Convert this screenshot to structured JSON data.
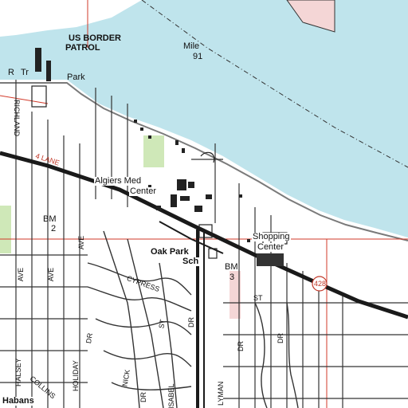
{
  "map": {
    "colors": {
      "water": "#bfe4ec",
      "land": "#ffffff",
      "grid_line": "#d23a2a",
      "road": "#1a1a1a",
      "park": "#cfe8b8",
      "building": "#222222",
      "urban_pink": "#f4d6d6"
    },
    "labels": {
      "us_border_patrol_1": "US BORDER",
      "us_border_patrol_2": "PATROL",
      "mile": "Mile",
      "mile_number": "91",
      "park_r": "R",
      "park_tr": "Tr",
      "park": "Park",
      "richland": "RICHLAND",
      "lane": "4 LANE",
      "algiers_med_1": "Algiers Med",
      "algiers_med_2": "Center",
      "bm_left": "BM",
      "bm_left_num": "2",
      "shopping_1": "Shopping",
      "shopping_2": "Center",
      "oak_park_1": "Oak Park",
      "oak_park_2": "Sch",
      "bm_right": "BM",
      "bm_right_num": "3",
      "route_shield": "428",
      "halsey": "HALSEY",
      "ave_1": "AVE",
      "ave_2": "AVE",
      "ave_3": "AVE",
      "collins": "COLLINS",
      "holiday": "HOLIDAY",
      "nick": "NICK",
      "dr_1": "DR",
      "dr_2": "DR",
      "dr_3": "DR",
      "dr_4": "DR",
      "dr_5": "DR",
      "st_1": "ST",
      "st_2": "ST",
      "isabel": "ISABEL",
      "lyman": "LYMAN",
      "habans": "Habans",
      "cypress": "CYPRESS"
    }
  }
}
